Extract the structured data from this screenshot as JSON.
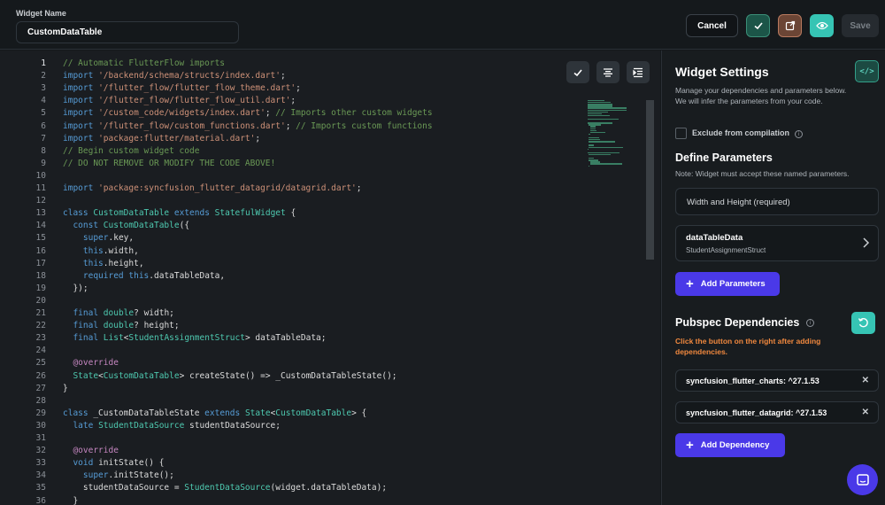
{
  "header": {
    "widget_name_label": "Widget Name",
    "widget_name_value": "CustomDataTable",
    "cancel_label": "Cancel",
    "save_label": "Save",
    "icons": [
      "check-icon",
      "open-external-icon",
      "eye-icon"
    ],
    "colors": {
      "check_bg": "#1c5548",
      "open_bg": "#6b4535",
      "eye_bg": "#36c4b4"
    }
  },
  "editor": {
    "active_line": 1,
    "toolbar_icons": [
      "check-icon",
      "align-center-icon",
      "indent-icon"
    ],
    "lines": [
      "// Automatic FlutterFlow imports",
      "import '/backend/schema/structs/index.dart';",
      "import '/flutter_flow/flutter_flow_theme.dart';",
      "import '/flutter_flow/flutter_flow_util.dart';",
      "import '/custom_code/widgets/index.dart'; // Imports other custom widgets",
      "import '/flutter_flow/custom_functions.dart'; // Imports custom functions",
      "import 'package:flutter/material.dart';",
      "// Begin custom widget code",
      "// DO NOT REMOVE OR MODIFY THE CODE ABOVE!",
      "",
      "import 'package:syncfusion_flutter_datagrid/datagrid.dart';",
      "",
      "class CustomDataTable extends StatefulWidget {",
      "  const CustomDataTable({",
      "    super.key,",
      "    this.width,",
      "    this.height,",
      "    required this.dataTableData,",
      "  });",
      "",
      "  final double? width;",
      "  final double? height;",
      "  final List<StudentAssignmentStruct> dataTableData;",
      "",
      "  @override",
      "  State<CustomDataTable> createState() => _CustomDataTableState();",
      "}",
      "",
      "class _CustomDataTableState extends State<CustomDataTable> {",
      "  late StudentDataSource studentDataSource;",
      "",
      "  @override",
      "  void initState() {",
      "    super.initState();",
      "    studentDataSource = StudentDataSource(widget.dataTableData);",
      "  }"
    ]
  },
  "settings": {
    "title": "Widget Settings",
    "code_button_icon": "code-icon",
    "description": "Manage your dependencies and parameters below.",
    "description2": "We will infer the parameters from your code.",
    "exclude_label": "Exclude from compilation",
    "define_params_title": "Define Parameters",
    "define_params_note": "Note: Widget must accept these named parameters.",
    "width_height_label": "Width and Height (required)",
    "param_name": "dataTableData",
    "param_type": "StudentAssignmentStruct",
    "add_params_label": "Add Parameters",
    "pubspec_title": "Pubspec Dependencies",
    "pubspec_warning": "Click the button on the right after adding dependencies.",
    "dependencies": [
      "syncfusion_flutter_charts: ^27.1.53",
      "syncfusion_flutter_datagrid: ^27.1.53"
    ],
    "add_dependency_label": "Add Dependency",
    "colors": {
      "accent": "#4a39e8",
      "teal": "#36c4b4",
      "warning": "#f0883e"
    }
  }
}
